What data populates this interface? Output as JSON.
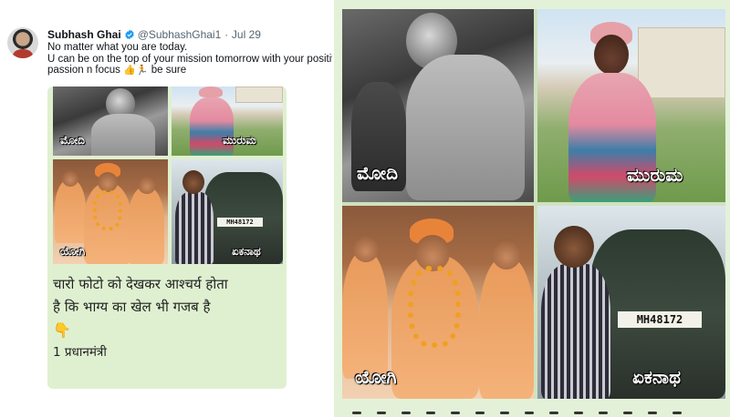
{
  "tweet": {
    "author_name": "Subhash Ghai",
    "handle": "@SubhashGhai1",
    "separator": "·",
    "date": "Jul 29",
    "text_line1": "No matter what you are today.",
    "text_line2": "U can be on the top of your mission tomorrow with your positive skil",
    "text_line3_a": "passion n focus",
    "text_line3_b": "be sure",
    "emoji_thumb": "👍",
    "emoji_run": "🏃"
  },
  "photos": {
    "labels": {
      "modi": "ಮೋದಿ",
      "murmu": "ಮುರುಮ",
      "yogi": "ಯೋಗಿ",
      "eknath": "ಏಕನಾಥ"
    },
    "plate": "MH48172"
  },
  "caption": {
    "line1": "चारो फोटो को देखकर आश्चर्य होता",
    "line2": "है कि भाग्य का खेल भी गजब है",
    "pointer": "👇",
    "item1": "1 प्रधानमंत्री"
  },
  "colors": {
    "card_background": "#e3f1d8",
    "label_text": "#ffffff",
    "handle_gray": "#536471",
    "verified_blue": "#1d9bf0"
  }
}
